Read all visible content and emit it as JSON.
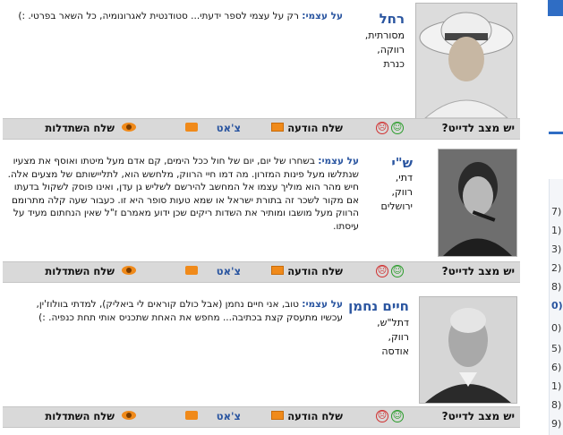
{
  "cards": [
    {
      "name": "רחל",
      "details": [
        "מסורתית,",
        "רווקה,",
        "כנרת"
      ],
      "about_label": "על עצמי:",
      "about_text": "רק על עצמי לספר ידעתי... סטודנטית לאגרונומיה, כל השאר בפרטי. :)",
      "diet_label": "יש מצב לדייט?",
      "message_label": "שלח הודעה",
      "chat_label": "צ'אט",
      "flirt_label": "שלח השתדלות"
    },
    {
      "name": "ש\"י",
      "details": [
        "דתי,",
        "רווק,",
        "ירושלים"
      ],
      "about_label": "על עצמי:",
      "about_text": "בשחרו של יום, יום של חול ככל הימים, קם אדם מעל מיטתו ואוסף את מצעיו שנתלשו מעל פינות המזרון. מה דמו חיי הרווק, מלחשש הוא, לתליישותם של מצעים אלה. חיש מהר הוא מוליך עצמו אל המחשב להירשם לשליש גן עדן, ואינו פוסק לשקול בדעתו אם מקור לשכר זה בתורת ישראל או שמא טעות סופר היא זו. כעבור שעה קלה מתרומם הרווק מעל מושבו ומותיר את השדות ריקים שכן ידוע מאמרם ז\"ל שאין הנחתום מעיד על עיסתו.",
      "diet_label": "יש מצב לדייט?",
      "message_label": "שלח הודעה",
      "chat_label": "צ'אט",
      "flirt_label": "שלח השתדלות"
    },
    {
      "name": "חיים נחמן",
      "details": [
        "דתל\"ש,",
        "רווק,",
        "אודסה"
      ],
      "about_label": "על עצמי:",
      "about_text": "טוב, אני חיים נחמן (אבל כולם קוראים לי ביאליק), למדתי בוולוז'ין, עכשיו מתעסק קצת בכתיבה... מחפש את האחת שתכניס אותי תחת כנפיה. :)",
      "diet_label": "יש מצב לדייט?",
      "message_label": "שלח הודעה",
      "chat_label": "צ'אט",
      "flirt_label": "שלח השתדלות"
    }
  ],
  "sidebar": {
    "items": [
      "(7",
      "(1",
      "(3",
      "(2",
      "(8",
      "(0",
      "(0",
      "(5",
      "(6",
      "(1",
      "(8",
      "(9"
    ]
  }
}
